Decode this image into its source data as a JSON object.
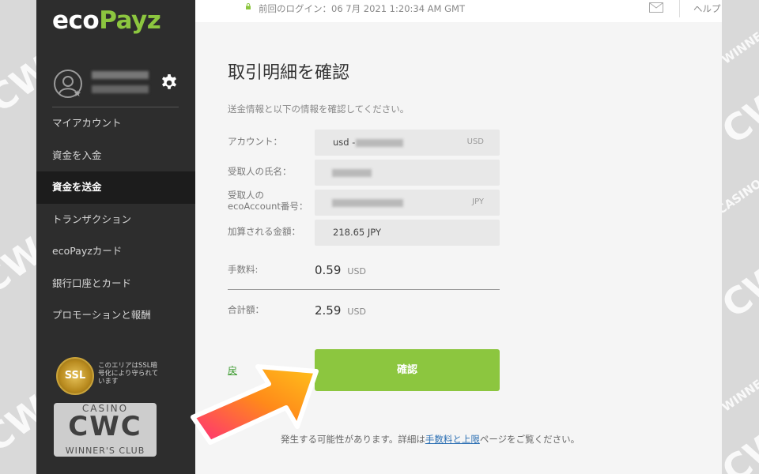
{
  "brand": {
    "logo_text_eco": "eco",
    "logo_text_payz": "Payz",
    "accent_color": "#8cc63f"
  },
  "header": {
    "last_login": "前回のログイン：06 7月 2021 1:20:34 AM GMT",
    "help_label": "ヘルプ"
  },
  "sidebar": {
    "icons": {
      "avatar": "user-avatar-icon",
      "settings": "gear-icon"
    },
    "items": [
      {
        "label": "マイアカウント",
        "active": false
      },
      {
        "label": "資金を入金",
        "active": false
      },
      {
        "label": "資金を送金",
        "active": true
      },
      {
        "label": "トランザクション",
        "active": false
      },
      {
        "label": "ecoPayzカード",
        "active": false
      },
      {
        "label": "銀行口座とカード",
        "active": false
      },
      {
        "label": "プロモーションと報酬",
        "active": false
      }
    ],
    "ssl_badge_text": "SSL",
    "ssl_note": "このエリアはSSL暗号化により守られています"
  },
  "main": {
    "title": "取引明細を確認",
    "instruction": "送金情報と以下の情報を確認してください。",
    "fields": {
      "account": {
        "label": "アカウント：",
        "value": "usd -",
        "currency": "USD"
      },
      "recipient_name": {
        "label": "受取人の氏名："
      },
      "recipient_account": {
        "label_line1": "受取人の",
        "label_line2": "ecoAccount番号：",
        "currency": "JPY"
      },
      "credited_amount": {
        "label": "加算される金額：",
        "value": "218.65 JPY"
      }
    },
    "fee": {
      "label": "手数料:",
      "amount": "0.59",
      "unit": "USD"
    },
    "total": {
      "label": "合計額：",
      "amount": "2.59",
      "unit": "USD"
    },
    "confirm_button": "確認",
    "back_link": "戻",
    "footnote_before": "発生する可能性があります。詳細は",
    "footnote_link": "手数料と上限",
    "footnote_after": "ページをご覧ください。"
  },
  "watermark": {
    "line1": "CASINO",
    "line2": "CWC",
    "line3": "WINNER'S CLUB"
  }
}
